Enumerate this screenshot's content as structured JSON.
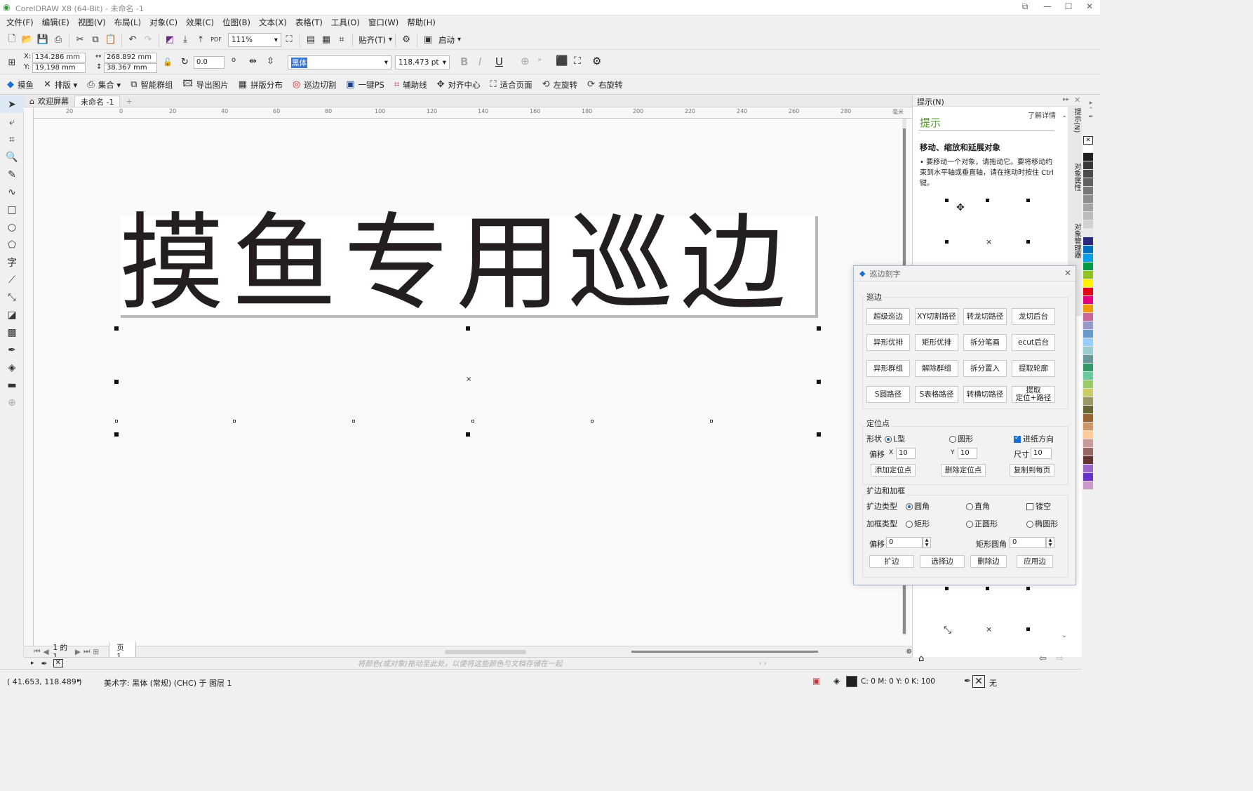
{
  "window": {
    "title": "CorelDRAW X8 (64-Bit) - 未命名 -1"
  },
  "menu": [
    "文件(F)",
    "编辑(E)",
    "视图(V)",
    "布局(L)",
    "对象(C)",
    "效果(C)",
    "位图(B)",
    "文本(X)",
    "表格(T)",
    "工具(O)",
    "窗口(W)",
    "帮助(H)"
  ],
  "stdbar": {
    "zoom": "111%",
    "snap_label": "贴齐(T)",
    "launch_label": "启动"
  },
  "propbar": {
    "x_label": "X:",
    "x": "134.286 mm",
    "y_label": "Y:",
    "y": "19.198 mm",
    "w": "268.892 mm",
    "h": "38.367 mm",
    "angle": "0.0",
    "angle_unit": "o",
    "font": "黑体",
    "font_size": "118.473 pt"
  },
  "plugin_toolbar": [
    {
      "icon": "fish-icon",
      "label": "摸鱼"
    },
    {
      "icon": "layout-icon",
      "label": "排版"
    },
    {
      "icon": "printer-icon",
      "label": "集合"
    },
    {
      "icon": "group-icon",
      "label": "智能群组"
    },
    {
      "icon": "image-icon",
      "label": "导出图片"
    },
    {
      "icon": "grid-icon",
      "label": "拼版分布"
    },
    {
      "icon": "contour-icon",
      "label": "巡边切割"
    },
    {
      "icon": "ps-icon",
      "label": "一键PS"
    },
    {
      "icon": "guides-icon",
      "label": "辅助线"
    },
    {
      "icon": "center-icon",
      "label": "对齐中心"
    },
    {
      "icon": "fit-page-icon",
      "label": "适合页面"
    },
    {
      "icon": "rotate-left-icon",
      "label": "左旋转"
    },
    {
      "icon": "rotate-right-icon",
      "label": "右旋转"
    }
  ],
  "doc_tabs": {
    "welcome": "欢迎屏幕",
    "doc": "未命名 -1"
  },
  "ruler_h": [
    "20",
    "0",
    "20",
    "40",
    "60",
    "80",
    "100",
    "120",
    "140",
    "160",
    "180",
    "200",
    "220",
    "240",
    "260",
    "280",
    "毫米"
  ],
  "artwork_text": "摸鱼专用巡边",
  "page_nav": {
    "page_of": "1 的 1",
    "page_tab": "页 1"
  },
  "color_hint": "将颜色(或对象)拖动至此处，以便将这些颜色与文档存储在一起",
  "status": {
    "coords": "( 41.653, 118.489 )",
    "object_info": "美术字: 黑体 (常规) (CHC) 于 图层 1",
    "fill_info": "C: 0 M: 0 Y: 0 K: 100",
    "outline_info": "无"
  },
  "hints": {
    "panel_title": "提示(N)",
    "heading": "提示",
    "learn_more": "了解详情",
    "subheading": "移动、缩放和延展对象",
    "body": "• 要移动一个对象，请拖动它。要将移动约束到水平轴或垂直轴，请在拖动时按住 Ctrl 键。"
  },
  "docker_tabs": [
    "提示(N)",
    "对象属性",
    "对象管理器"
  ],
  "palette": [
    "#ffffff",
    "#231f20",
    "#3b3738",
    "#4d4a4b",
    "#636061",
    "#7a7778",
    "#8f8d8e",
    "#a5a3a4",
    "#bcbbbb",
    "#d3d2d2",
    "#e9e9e9",
    "#2b2a7a",
    "#0070c0",
    "#00a0e9",
    "#009944",
    "#8fc31f",
    "#fff100",
    "#e60012",
    "#e4007f",
    "#f39800",
    "#cc6699",
    "#9999cc",
    "#6699cc",
    "#99ccff",
    "#99cccc",
    "#669999",
    "#339966",
    "#66cc99",
    "#99cc66",
    "#cccc66",
    "#999966",
    "#666633",
    "#996633",
    "#cc9966",
    "#ffcc99",
    "#cc9999",
    "#996666",
    "#663333",
    "#9966cc",
    "#6633cc",
    "#cc99cc"
  ],
  "dialog": {
    "title": "巡边刻字",
    "group_edge": "巡边",
    "edge_buttons": [
      "超级巡边",
      "XY切割路径",
      "转龙切路径",
      "龙切后台",
      "异形优排",
      "矩形优排",
      "拆分笔画",
      "ecut后台",
      "异形群组",
      "解除群组",
      "拆分置入",
      "提取轮廓",
      "S圆路径",
      "S表格路径",
      "转横切路径",
      "提取\n定位+路径"
    ],
    "group_mark": "定位点",
    "shape_label": "形状",
    "shape_l": "L型",
    "shape_circle": "圆形",
    "feed_dir": "进纸方向",
    "offset_label": "偏移",
    "x_label": "X",
    "x_val": "10",
    "y_label": "Y",
    "y_val": "10",
    "size_label": "尺寸",
    "size_val": "10",
    "add_mark": "添加定位点",
    "del_mark": "删除定位点",
    "copy_page": "复制到每页",
    "group_expand": "扩边和加框",
    "expand_type": "扩边类型",
    "round": "圆角",
    "straight": "直角",
    "hollow": "镂空",
    "frame_type": "加框类型",
    "rect": "矩形",
    "circle": "正圆形",
    "ellipse": "椭圆形",
    "offset2": "偏移",
    "offset2_val": "0",
    "rect_radius": "矩形圆角",
    "radius_val": "0",
    "btn_expand": "扩边",
    "btn_select": "选择边",
    "btn_delete": "删除边",
    "btn_apply": "应用边"
  }
}
